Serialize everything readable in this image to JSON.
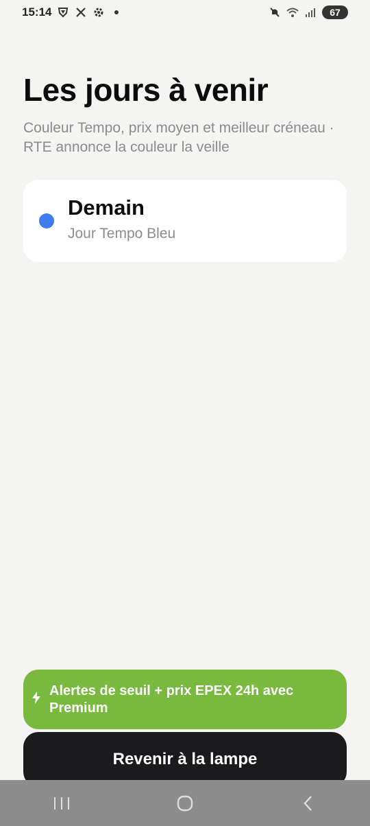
{
  "status_bar": {
    "time": "15:14",
    "left_icons": [
      "shield-icon",
      "x-logo-icon",
      "gear-icon",
      "dot-icon"
    ],
    "right_icons": [
      "muted-icon",
      "wifi-icon",
      "signal-icon"
    ],
    "battery": "67"
  },
  "header": {
    "title": "Les jours à venir",
    "subtitle": "Couleur Tempo, prix moyen et meilleur créneau · RTE annonce la couleur la veille"
  },
  "days": [
    {
      "title": "Demain",
      "subtitle": "Jour Tempo Bleu",
      "color": "#3d7bee"
    }
  ],
  "premium_banner": {
    "text": "Alertes de seuil + prix EPEX 24h avec Premium",
    "icon": "bolt-icon",
    "color": "#79ba3e"
  },
  "back_button": {
    "label": "Revenir à la lampe"
  },
  "nav_bar": {
    "buttons": [
      "recents-icon",
      "home-icon",
      "back-icon"
    ]
  }
}
